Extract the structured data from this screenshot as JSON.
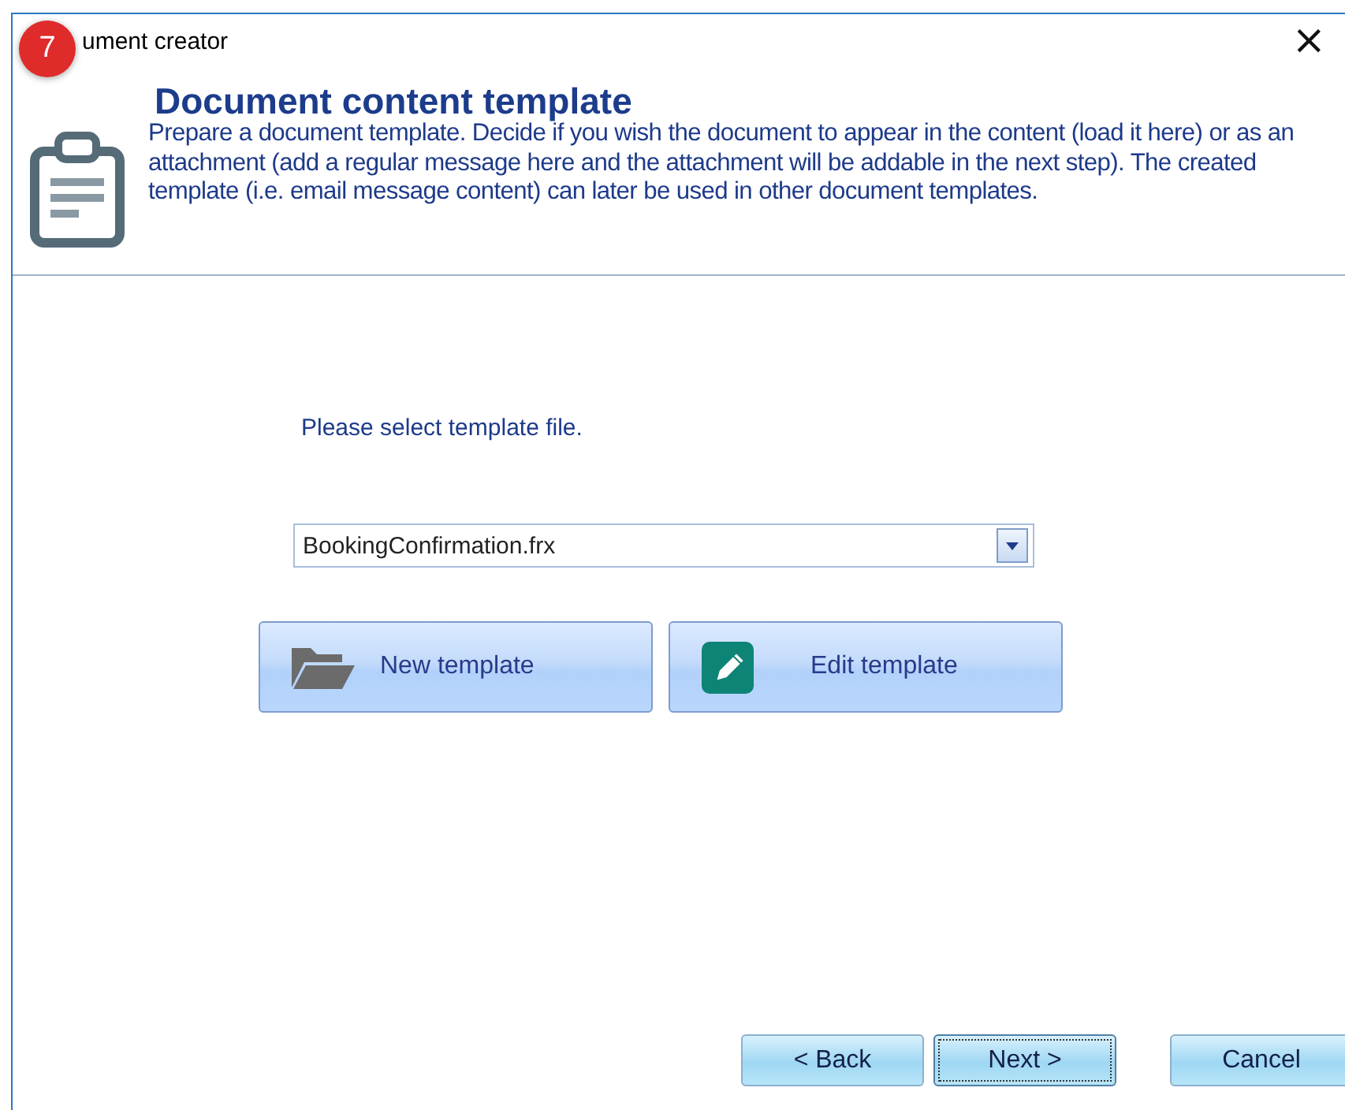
{
  "window": {
    "title": "ument creator",
    "badge": "7",
    "close": "×"
  },
  "header": {
    "title": "Document content template",
    "description": "Prepare a document template. Decide if you wish the document to appear in the content (load it here) or as an attachment (add a regular message here and the attachment will be addable in the next step). The created template (i.e. email message content) can later be used in other document templates."
  },
  "prompt": "Please select template file.",
  "template_select": {
    "value": "BookingConfirmation.frx"
  },
  "actions": [
    {
      "label": "New template",
      "kind": "folder"
    },
    {
      "label": "Edit template",
      "kind": "edit"
    }
  ],
  "footer_buttons": [
    {
      "label": "< Back",
      "focused": false
    },
    {
      "label": "Next >",
      "focused": true
    },
    {
      "label": "Cancel",
      "focused": false
    }
  ]
}
